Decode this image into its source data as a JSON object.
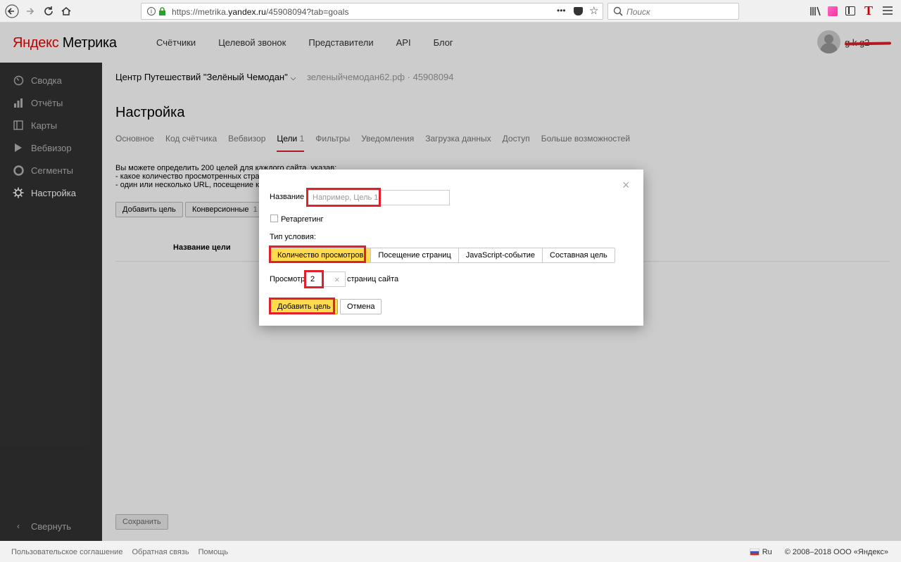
{
  "browser": {
    "url_prefix": "https://metrika.",
    "url_domain": "yandex.ru",
    "url_suffix": "/45908094?tab=goals",
    "search_placeholder": "Поиск",
    "more_icon": "•••"
  },
  "header": {
    "logo_ya": "Яндекс",
    "logo_rest": " Метрика",
    "nav": [
      "Счётчики",
      "Целевой звонок",
      "Представители",
      "API",
      "Блог"
    ],
    "username": "g        k  g2"
  },
  "sidebar": {
    "items": [
      {
        "label": "Сводка",
        "icon": "gauge-icon"
      },
      {
        "label": "Отчёты",
        "icon": "bar-chart-icon"
      },
      {
        "label": "Карты",
        "icon": "map-icon"
      },
      {
        "label": "Вебвизор",
        "icon": "play-icon"
      },
      {
        "label": "Сегменты",
        "icon": "pie-icon"
      },
      {
        "label": "Настройка",
        "icon": "gear-icon"
      }
    ],
    "collapse": "Свернуть"
  },
  "content": {
    "site_name": "Центр Путешествий \"Зелёный Чемодан\"",
    "site_domain": "зеленыйчемодан62.рф · 45908094",
    "title": "Настройка",
    "tabs": [
      {
        "label": "Основное"
      },
      {
        "label": "Код счётчика"
      },
      {
        "label": "Вебвизор"
      },
      {
        "label": "Цели",
        "count": "1",
        "active": true
      },
      {
        "label": "Фильтры"
      },
      {
        "label": "Уведомления"
      },
      {
        "label": "Загрузка данных"
      },
      {
        "label": "Доступ"
      },
      {
        "label": "Больше возможностей"
      }
    ],
    "intro_line1": "Вы можете определить 200 целей для каждого сайта, указав:",
    "intro_line2": "-  какое количество просмотренных стран",
    "intro_line3": "-  один или несколько URL, посещение кото",
    "add_goal": "Добавить цель",
    "conversion": "Конверсионные",
    "conversion_count": "1",
    "col_goal_name": "Название цели",
    "save": "Сохранить"
  },
  "modal": {
    "name_label": "Название",
    "name_placeholder": "Например, Цель 1",
    "retargeting": "Ретаргетинг",
    "condition_label": "Тип условия:",
    "conditions": [
      "Количество просмотров",
      "Посещение страниц",
      "JavaScript-событие",
      "Составная цель"
    ],
    "views_label": "Просмотр",
    "views_value": "2",
    "views_suffix": "страниц сайта",
    "submit": "Добавить цель",
    "cancel": "Отмена"
  },
  "footer": {
    "links": [
      "Пользовательское соглашение",
      "Обратная связь",
      "Помощь"
    ],
    "lang": "Ru",
    "copyright": "© 2008–2018 ООО «Яндекс»"
  },
  "colors": {
    "accent": "#ffdb4d",
    "highlight": "#e0202a",
    "sidebar": "#333333"
  }
}
